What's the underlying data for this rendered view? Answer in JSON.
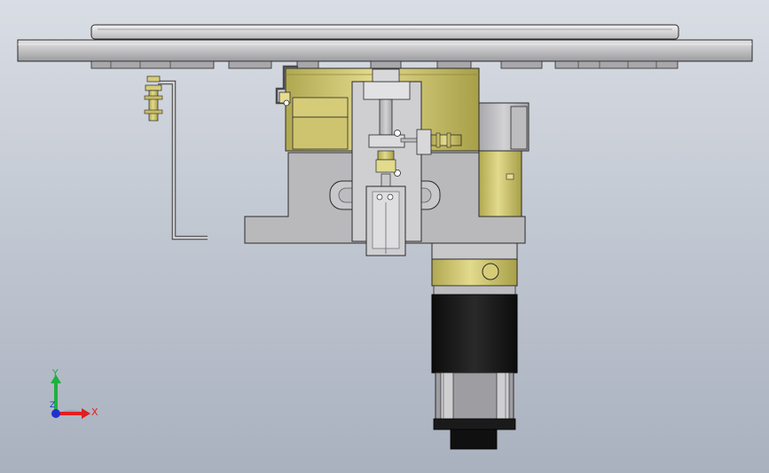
{
  "triad": {
    "x_label": "X",
    "y_label": "Y",
    "z_label": "Z",
    "x_color": "#e02020",
    "y_color": "#20b040",
    "z_color": "#2030d0"
  },
  "colors": {
    "background_top": "#d9dde4",
    "background_bottom": "#a9b1bf",
    "steel": "#c6c6c8",
    "brass": "#c9c070",
    "motor_black": "#161616",
    "outline": "#2a2a2a"
  },
  "icons": {
    "triad": "coordinate-triad-icon"
  }
}
